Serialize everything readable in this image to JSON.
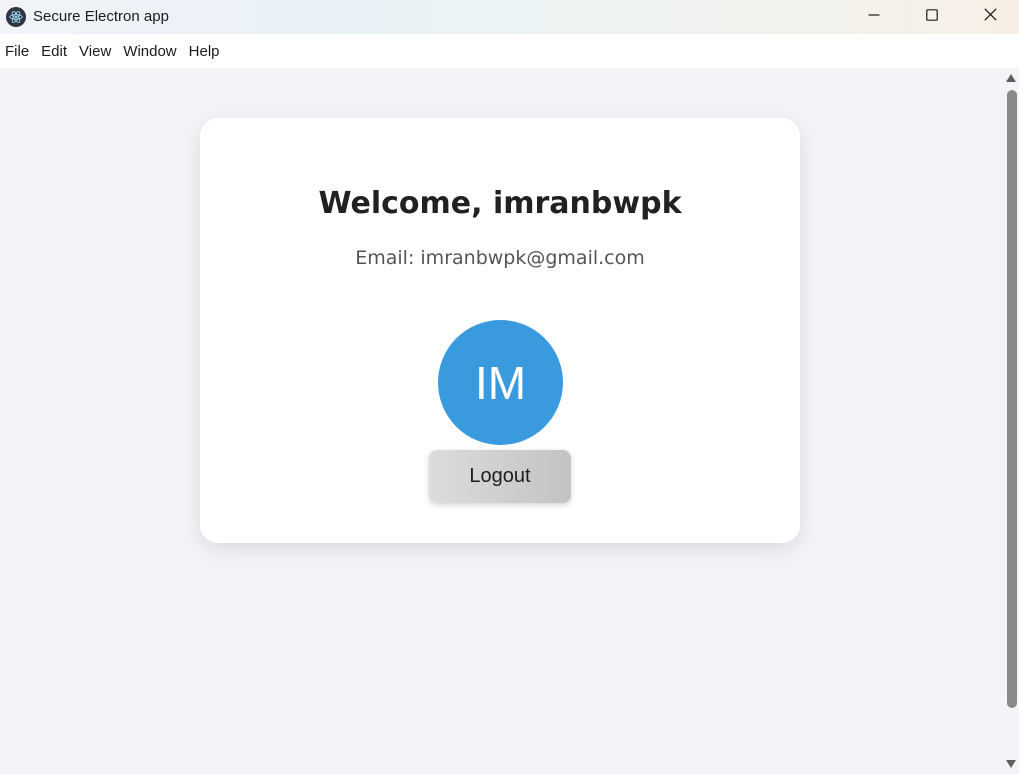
{
  "window": {
    "title": "Secure Electron app",
    "app_icon": "electron-icon",
    "controls": [
      "minimize-icon",
      "maximize-icon",
      "close-icon"
    ]
  },
  "menu": {
    "items": [
      "File",
      "Edit",
      "View",
      "Window",
      "Help"
    ]
  },
  "profile": {
    "welcome": "Welcome, imranbwpk",
    "email": "Email: imranbwpk@gmail.com",
    "avatar_initials": "IM",
    "avatar_color": "#3a9ade",
    "logout_label": "Logout"
  }
}
